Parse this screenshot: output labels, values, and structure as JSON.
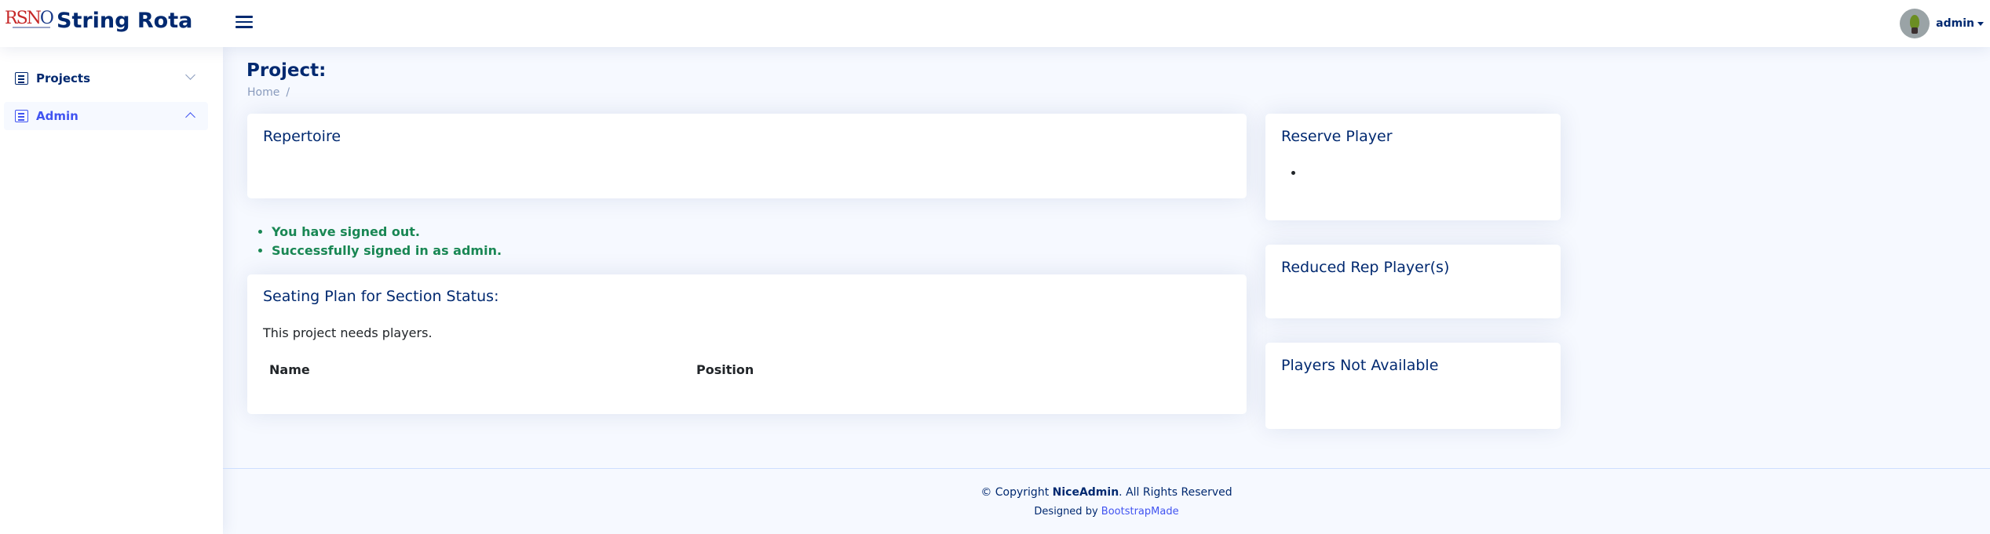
{
  "header": {
    "logo_text": "RSNO",
    "app_title": "String Rota",
    "menu_toggle_icon": "hamburger-icon",
    "user": {
      "name": "admin"
    }
  },
  "sidebar": {
    "items": [
      {
        "label": "Projects",
        "icon": "list-icon",
        "chevron": "chevron-down-icon"
      },
      {
        "label": "Admin",
        "icon": "list-icon",
        "chevron": "chevron-up-icon"
      }
    ]
  },
  "main": {
    "page_title": "Project:",
    "breadcrumb": {
      "home": "Home",
      "separator": "/"
    },
    "repertoire": {
      "title": "Repertoire"
    },
    "alerts": [
      "You have signed out.",
      "Successfully signed in as admin."
    ],
    "seating": {
      "title": "Seating Plan for Section Status:",
      "message": "This project needs players.",
      "columns": [
        "Name",
        "Position"
      ]
    },
    "reserve": {
      "title": "Reserve Player",
      "items": [
        ""
      ]
    },
    "reduced": {
      "title": "Reduced Rep Player(s)"
    },
    "not_available": {
      "title": "Players Not Available"
    }
  },
  "footer": {
    "copyright_prefix": "© Copyright ",
    "brand": "NiceAdmin",
    "copyright_suffix": ". All Rights Reserved",
    "designed_by": "Designed by ",
    "designer": "BootstrapMade"
  },
  "colors": {
    "primary": "#012970",
    "accent": "#4154f1",
    "success": "#198754",
    "background": "#f6f9ff"
  }
}
